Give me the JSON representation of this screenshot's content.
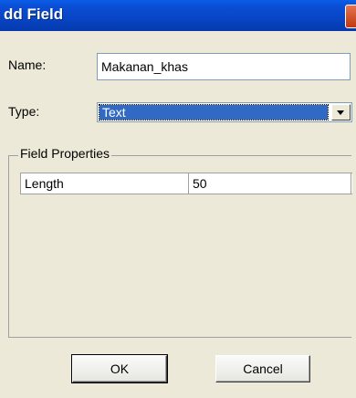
{
  "window": {
    "title": "dd Field"
  },
  "form": {
    "name_label": "Name:",
    "name_value": "Makanan_khas",
    "type_label": "Type:",
    "type_value": "Text"
  },
  "field_properties": {
    "title": "Field Properties",
    "rows": [
      {
        "key": "Length",
        "value": "50"
      }
    ]
  },
  "buttons": {
    "ok": "OK",
    "cancel": "Cancel"
  },
  "colors": {
    "titlebar": "#0846c8",
    "dialog_bg": "#ece9d8",
    "selection": "#316ac5",
    "close_button": "#c1370f"
  }
}
